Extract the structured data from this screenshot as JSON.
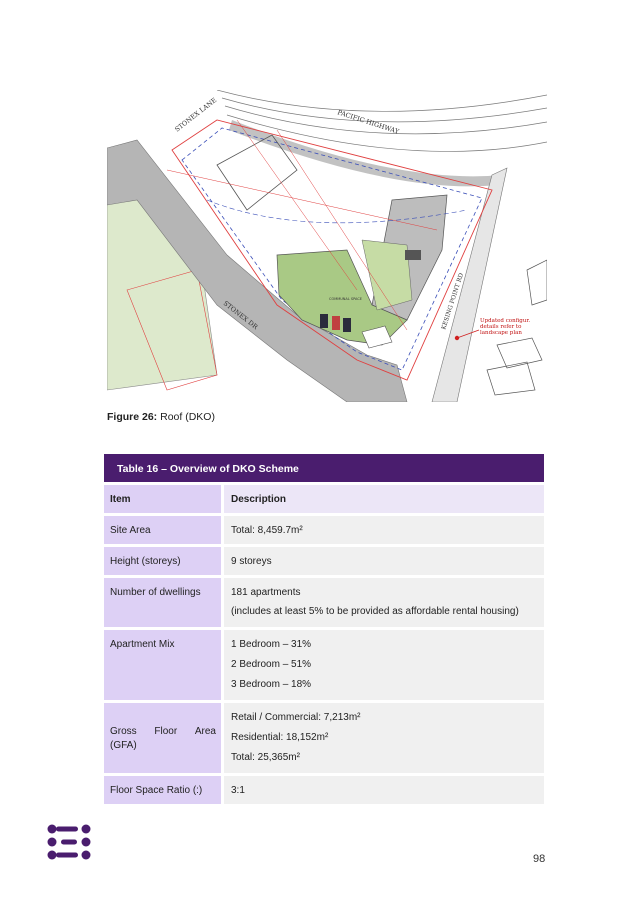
{
  "figure": {
    "caption_label": "Figure 26:",
    "caption_text": " Roof (DKO)",
    "map_labels": {
      "stonex_lane": "STONEX LANE",
      "pacific_highway": "PACIFIC HIGHWAY",
      "stonex_dr": "STONEX DR",
      "kesing_point_rd": "KESING POINT RD",
      "communal_space": "COMMUNAL SPACE",
      "annotation": [
        "Updated configur.",
        "details refer to",
        "landscape plan"
      ]
    }
  },
  "table": {
    "title": "Table 16 – Overview of DKO Scheme",
    "header": {
      "item": "Item",
      "description": "Description"
    },
    "rows": [
      {
        "item": "Site Area",
        "lines": [
          "Total: 8,459.7m²"
        ]
      },
      {
        "item": "Height (storeys)",
        "lines": [
          "9 storeys"
        ]
      },
      {
        "item": "Number of dwellings",
        "lines": [
          "181 apartments",
          "(includes at least 5% to be provided as affordable rental housing)"
        ]
      },
      {
        "item": "Apartment Mix",
        "lines": [
          "1 Bedroom – 31%",
          "2 Bedroom – 51%",
          "3 Bedroom – 18%"
        ]
      },
      {
        "item_parts": [
          "Gross",
          "Floor",
          "Area"
        ],
        "item_tail": "(GFA)",
        "lines": [
          "Retail / Commercial: 7,213m²",
          "Residential: 18,152m²",
          "Total: 25,365m²"
        ]
      },
      {
        "item": "Floor Space Ratio (:)",
        "lines": [
          "3:1"
        ]
      }
    ]
  },
  "footer": {
    "page_number": "98"
  },
  "colors": {
    "brand_purple": "#4a1d6e",
    "label_purple": "#ddd0f5",
    "cell_grey": "#f0f0f0"
  }
}
